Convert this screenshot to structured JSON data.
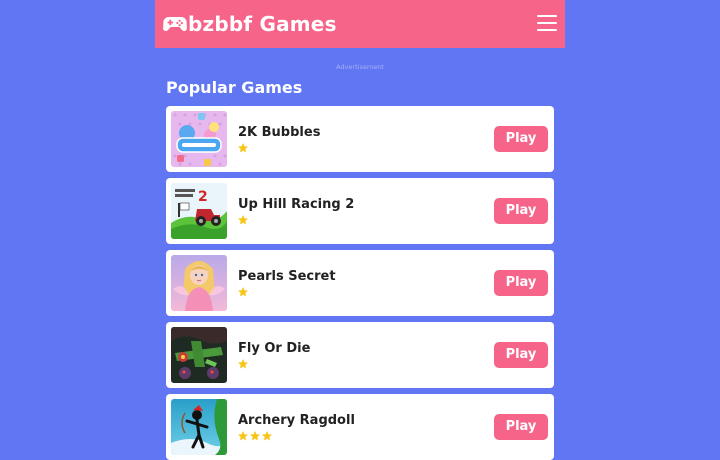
{
  "header": {
    "brand": "bzbbf Games",
    "logo_icon": "gamepad-icon",
    "menu_icon": "hamburger-menu-icon"
  },
  "ad_label": "Advertisement",
  "section_title": "Popular Games",
  "colors": {
    "background": "#6176f2",
    "header": "#f6648a",
    "play_button": "#f6648a",
    "star": "#f5c518"
  },
  "games": [
    {
      "title": "2K Bubbles",
      "stars": 1,
      "button": "Play",
      "thumb_icon": "bubbles-thumbnail"
    },
    {
      "title": "Up Hill Racing 2",
      "stars": 1,
      "button": "Play",
      "thumb_icon": "racing-thumbnail"
    },
    {
      "title": "Pearls Secret",
      "stars": 1,
      "button": "Play",
      "thumb_icon": "princess-thumbnail"
    },
    {
      "title": "Fly Or Die",
      "stars": 1,
      "button": "Play",
      "thumb_icon": "plane-thumbnail"
    },
    {
      "title": "Archery Ragdoll",
      "stars": 3,
      "button": "Play",
      "thumb_icon": "archer-thumbnail"
    }
  ]
}
